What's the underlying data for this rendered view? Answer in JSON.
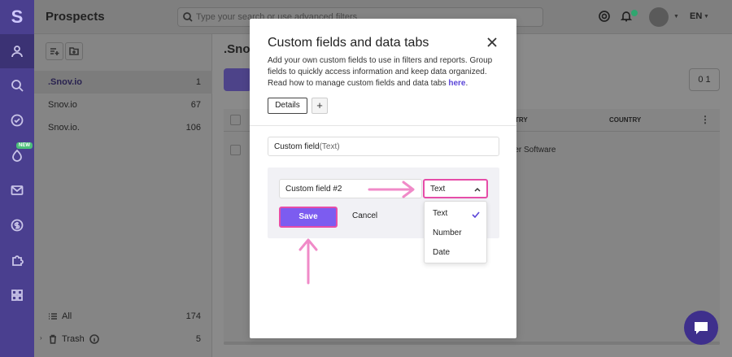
{
  "colors": {
    "rail": "#4a3f8f",
    "accent": "#7c5cf0",
    "highlight": "#e64da8",
    "overlay": "#8a8a8a",
    "link": "#5b46d8"
  },
  "app": {
    "logo": "S",
    "title": "Prospects",
    "search_placeholder": "Type your search or use advanced filters",
    "language": "EN",
    "new_badge": "NEW"
  },
  "rail_icons": [
    "prospects-icon",
    "search-icon",
    "check-icon",
    "drip-icon",
    "mail-icon",
    "dollar-icon",
    "puzzle-icon",
    "apps-icon"
  ],
  "lists": [
    {
      "name": ".Snov.io",
      "count": "1",
      "active": true
    },
    {
      "name": "Snov.io",
      "count": "67"
    },
    {
      "name": "Snov.io.",
      "count": "106"
    }
  ],
  "bottom": {
    "all_label": "All",
    "all_count": "174",
    "trash_label": "Trash",
    "trash_count": "5"
  },
  "main": {
    "title": ".Snov",
    "count_btn": "0 1",
    "columns": [
      "TRY",
      "COUNTRY"
    ],
    "row_cell": "uter Software"
  },
  "modal": {
    "title": "Custom fields and data tabs",
    "description": "Add your own custom fields to use in filters and reports. Group fields to quickly access information and keep data organized. Read how to manage custom fields and data tabs ",
    "link_text": "here",
    "link_suffix": ".",
    "tab_details": "Details",
    "tab_add": "+",
    "existing_field_name": "Custom field",
    "existing_field_type": "(Text)",
    "new_field_value": "Custom field #2",
    "type_selected": "Text",
    "save_label": "Save",
    "cancel_label": "Cancel",
    "type_options": [
      "Text",
      "Number",
      "Date"
    ]
  }
}
